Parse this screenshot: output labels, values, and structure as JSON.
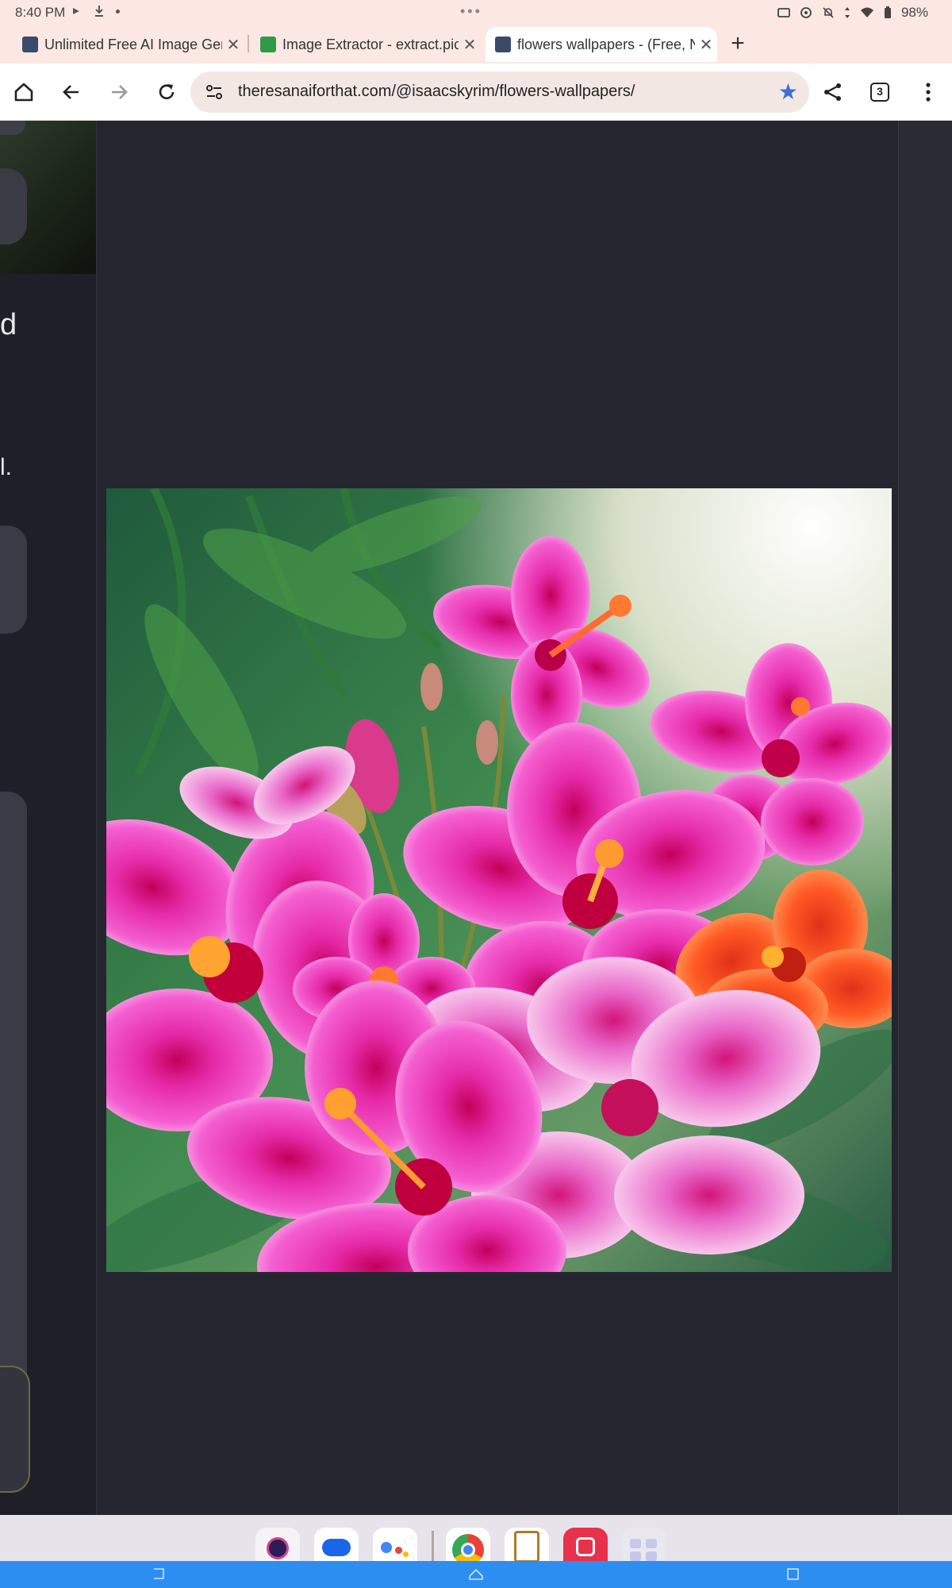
{
  "status_bar": {
    "time": "8:40 PM",
    "battery": "98%"
  },
  "tabs": [
    {
      "title": "Unlimited Free AI Image Gen",
      "favicon_color": "#3b4a6b",
      "active": false
    },
    {
      "title": "Image Extractor - extract.pic",
      "favicon_color": "#2e9a4a",
      "active": false
    },
    {
      "title": "flowers wallpapers - (Free, N",
      "favicon_color": "#3b4a6b",
      "active": true
    }
  ],
  "toolbar": {
    "url": "theresanaiforthat.com/@isaacskyrim/flowers-wallpapers/",
    "tab_count": "3",
    "bookmarked": true
  },
  "page": {
    "left_fragment_letter": "d",
    "left_fragment_punct": "l.",
    "image_subject": "pink hibiscus flowers wallpaper"
  },
  "dock": {
    "apps": [
      "camera-app",
      "messages-app",
      "assistant-app",
      "chrome-app",
      "clipboard-app",
      "screenshot-app",
      "app-drawer"
    ]
  },
  "colors": {
    "chrome_background": "#fbe8e2",
    "page_background": "#25252f",
    "accent_star": "#3b6fd4",
    "nav_bar": "#2d8ef2"
  }
}
